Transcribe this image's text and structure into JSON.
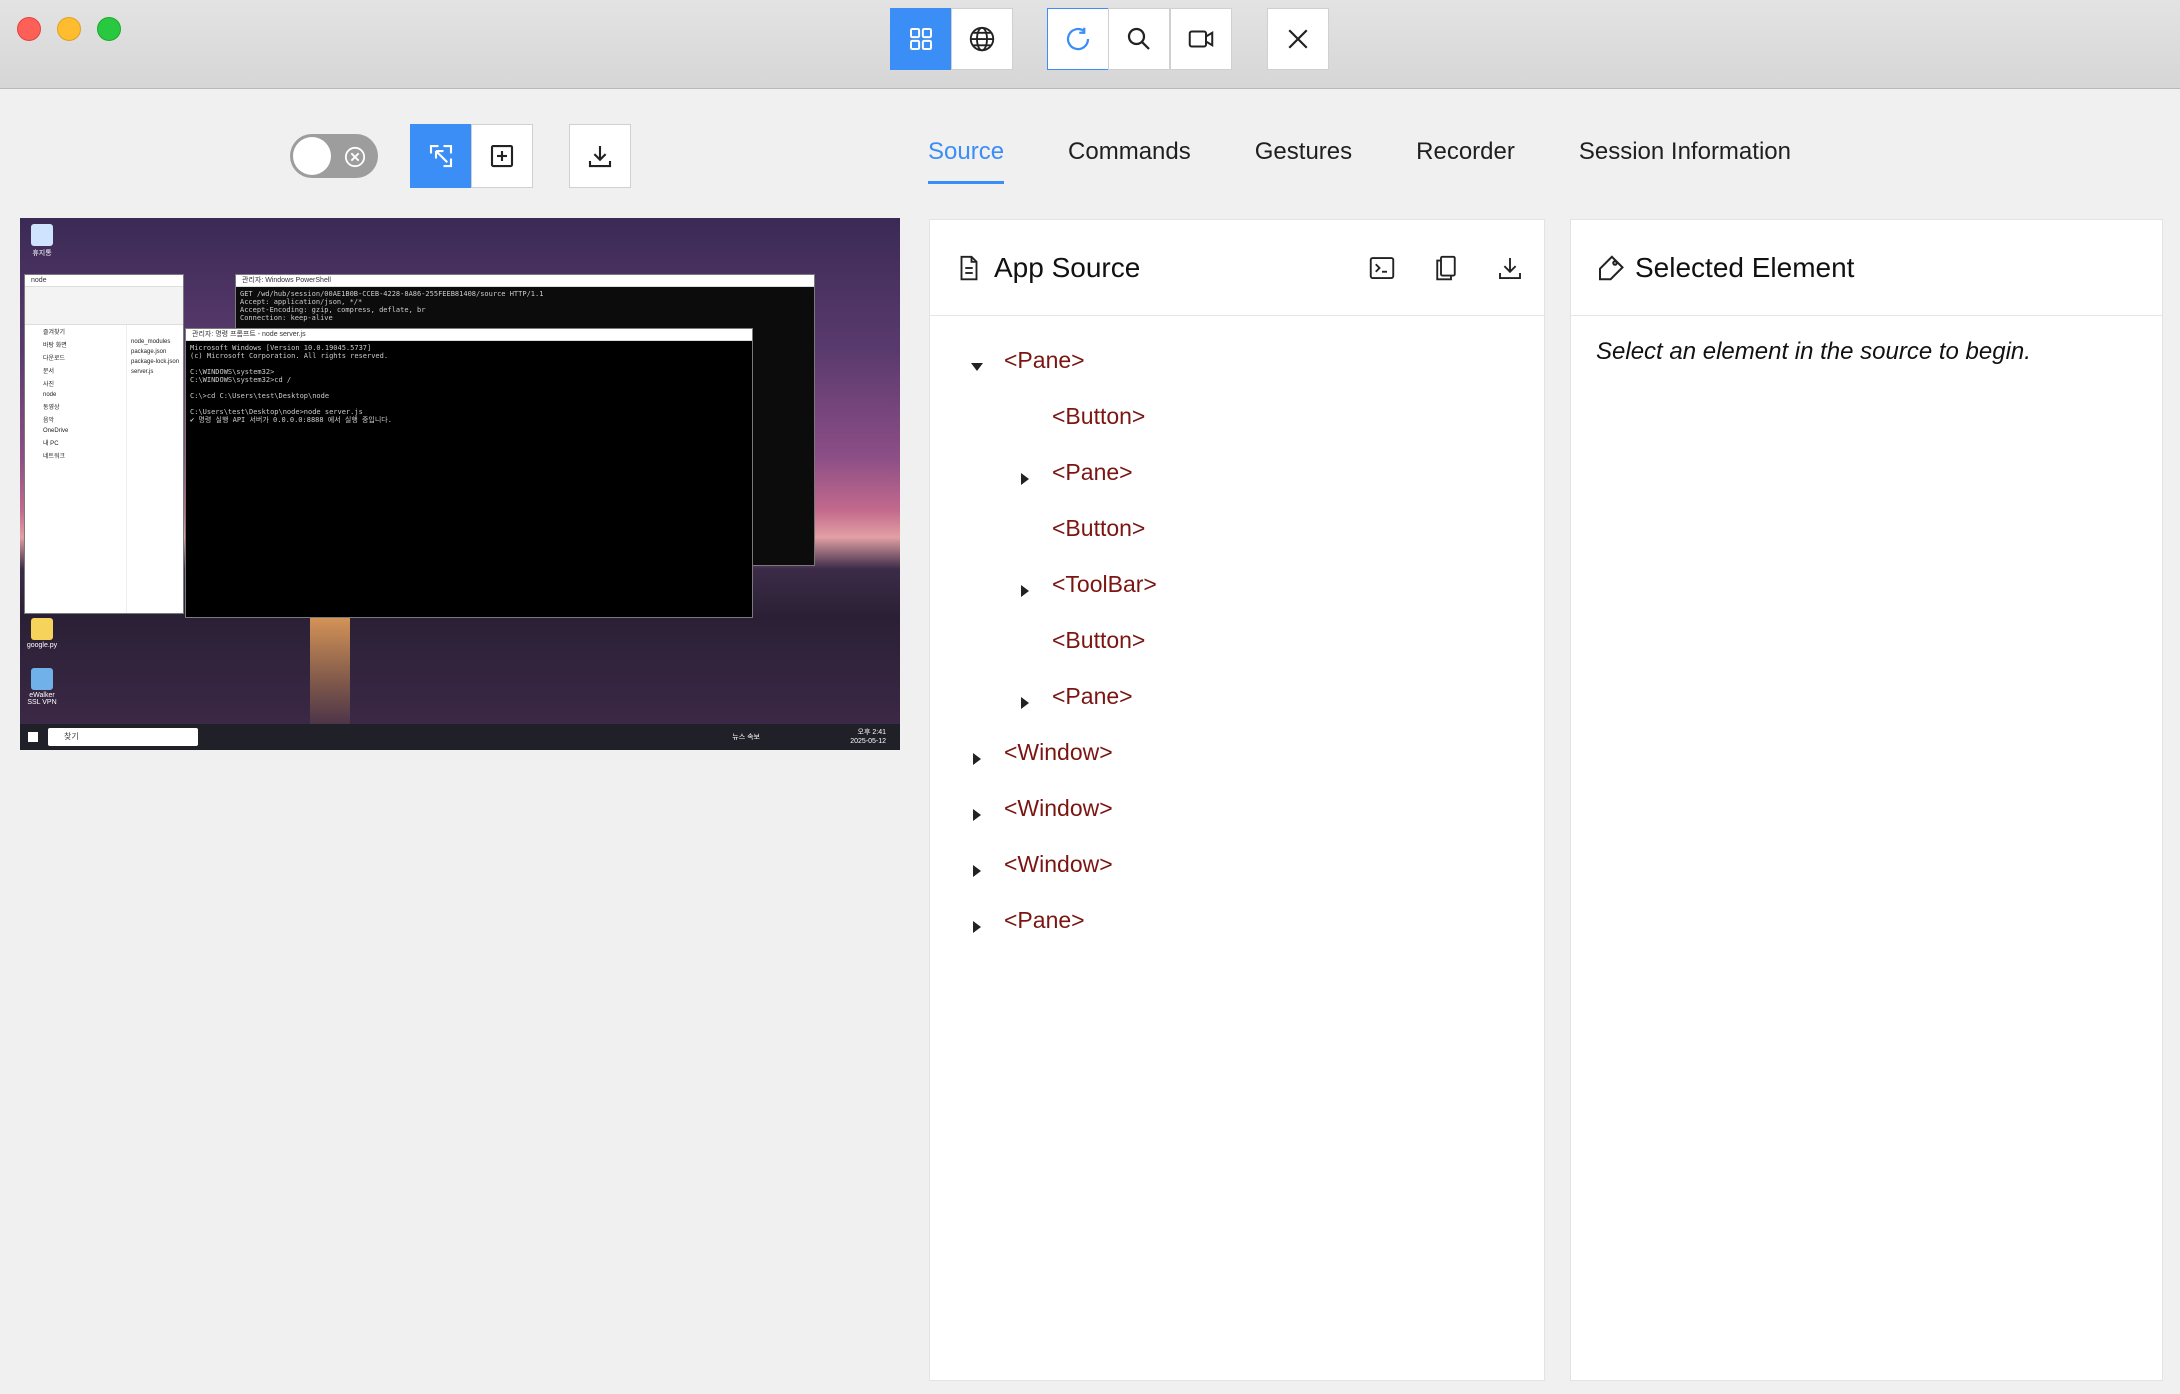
{
  "window": {
    "title": "",
    "toolbar_icons": [
      "grid-icon",
      "globe-icon",
      "refresh-icon",
      "search-icon",
      "video-icon",
      "close-icon"
    ]
  },
  "toolbar": {
    "toggle": "off",
    "buttons": [
      "select-element-icon",
      "tap-coordinates-icon",
      "download-icon"
    ]
  },
  "tabs": [
    {
      "label": "Source",
      "active": true
    },
    {
      "label": "Commands",
      "active": false
    },
    {
      "label": "Gestures",
      "active": false
    },
    {
      "label": "Recorder",
      "active": false
    },
    {
      "label": "Session Information",
      "active": false
    }
  ],
  "app_source": {
    "title": "App Source",
    "actions": [
      "terminal-icon",
      "copy-icon",
      "download-icon"
    ],
    "tree": [
      {
        "label": "<Pane>",
        "depth": 0,
        "caret": "expanded"
      },
      {
        "label": "<Button>",
        "depth": 1,
        "caret": "none"
      },
      {
        "label": "<Pane>",
        "depth": 1,
        "caret": "collapsed"
      },
      {
        "label": "<Button>",
        "depth": 1,
        "caret": "none"
      },
      {
        "label": "<ToolBar>",
        "depth": 1,
        "caret": "collapsed"
      },
      {
        "label": "<Button>",
        "depth": 1,
        "caret": "none"
      },
      {
        "label": "<Pane>",
        "depth": 1,
        "caret": "collapsed"
      },
      {
        "label": "<Window>",
        "depth": 0,
        "caret": "collapsed"
      },
      {
        "label": "<Window>",
        "depth": 0,
        "caret": "collapsed"
      },
      {
        "label": "<Window>",
        "depth": 0,
        "caret": "collapsed"
      },
      {
        "label": "<Pane>",
        "depth": 0,
        "caret": "collapsed"
      }
    ]
  },
  "selected_element": {
    "title": "Selected Element",
    "hint": "Select an element in the source to begin."
  },
  "device_screenshot": {
    "explorer_title": "node",
    "explorer_items": [
      "즐겨찾기",
      "바탕 화면",
      "다운로드",
      "문서",
      "사진",
      "node",
      "동영상",
      "음악",
      "OneDrive",
      "내 PC",
      "네트워크"
    ],
    "explorer_files": [
      "node_modules",
      "package.json",
      "package-lock.json",
      "server.js"
    ],
    "powershell_title": "관리자: Windows PowerShell",
    "powershell_text": "GET /wd/hub/session/00AE1B0B-CCEB-4228-8A86-255FEEB81408/source HTTP/1.1\nAccept: application/json, */*\nAccept-Encoding: gzip, compress, deflate, br\nConnection: keep-alive",
    "cmd_title": "관리자: 명령 프롬프트 - node  server.js",
    "cmd_text": "Microsoft Windows [Version 10.0.19045.5737]\n(c) Microsoft Corporation. All rights reserved.\n\nC:\\WINDOWS\\system32>\nC:\\WINDOWS\\system32>cd /\n\nC:\\>cd C:\\Users\\test\\Desktop\\node\n\nC:\\Users\\test\\Desktop\\node>node server.js\n✔ 명령 실행 API 서버가 0.0.0.0:8888 에서 실행 중입니다.",
    "taskbar_search": "찾기",
    "tray_news": "뉴스 속보",
    "tray_time": "오후 2:41",
    "tray_date": "2025-05-12",
    "desktop_icons": [
      "휴지통",
      "google.py",
      "eWalker SSL VPN"
    ]
  },
  "colors": {
    "accent": "#3a8ef5",
    "tree_text": "#7a1511"
  }
}
